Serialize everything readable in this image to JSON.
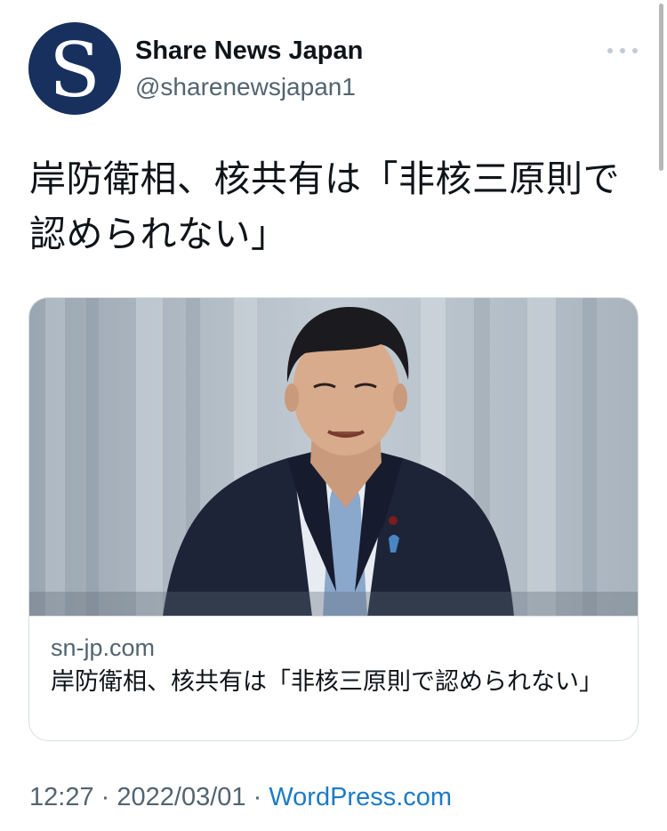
{
  "author": {
    "avatar_letter": "S",
    "name": "Share News Japan",
    "handle": "@sharenewsjapan1"
  },
  "more_icon": "more-horizontal-icon",
  "tweet": {
    "text": "岸防衛相、核共有は「非核三原則で認められない」"
  },
  "card": {
    "domain": "sn-jp.com",
    "title": "岸防衛相、核共有は「非核三原則で認められない」"
  },
  "meta": {
    "time": "12:27",
    "separator": "·",
    "date": "2022/03/01",
    "source": "WordPress.com"
  },
  "colors": {
    "avatar_bg": "#17305e",
    "link": "#1d7bc4",
    "secondary_text": "#536471",
    "border": "#d7dee2"
  }
}
